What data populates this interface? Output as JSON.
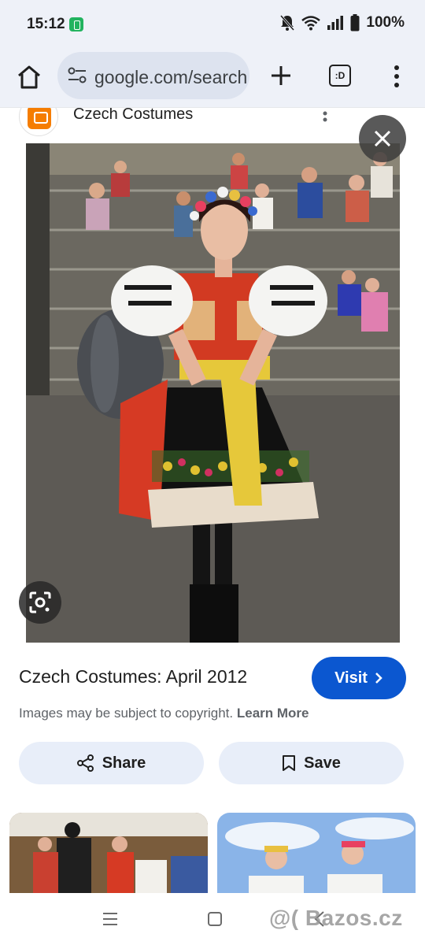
{
  "status_bar": {
    "time": "15:12",
    "battery_percent": "100%",
    "icons": [
      "messaging-app-icon",
      "bell-muted-icon",
      "wifi-icon",
      "signal-icon",
      "battery-icon"
    ]
  },
  "browser": {
    "url_display": "google.com/search",
    "tab_switcher_label": ":D",
    "icons": [
      "home-icon",
      "tune-icon",
      "plus-icon",
      "tab-switcher-icon",
      "more-vert-icon"
    ]
  },
  "source": {
    "name": "Czech Costumes",
    "favicon": "blogger-icon"
  },
  "image_viewer": {
    "icons": [
      "close-icon",
      "lens-icon"
    ]
  },
  "result": {
    "title": "Czech Costumes: April 2012",
    "visit_label": "Visit",
    "copyright_text": "Images may be subject to copyright.",
    "learn_more": "Learn More",
    "share_label": "Share",
    "save_label": "Save"
  },
  "watermark": "@( Bazos.cz",
  "colors": {
    "visit_button": "#0b57d0",
    "action_button": "#e8eef9",
    "toolbar_bg": "#eef1f8",
    "blogger_orange": "#f57d00"
  }
}
